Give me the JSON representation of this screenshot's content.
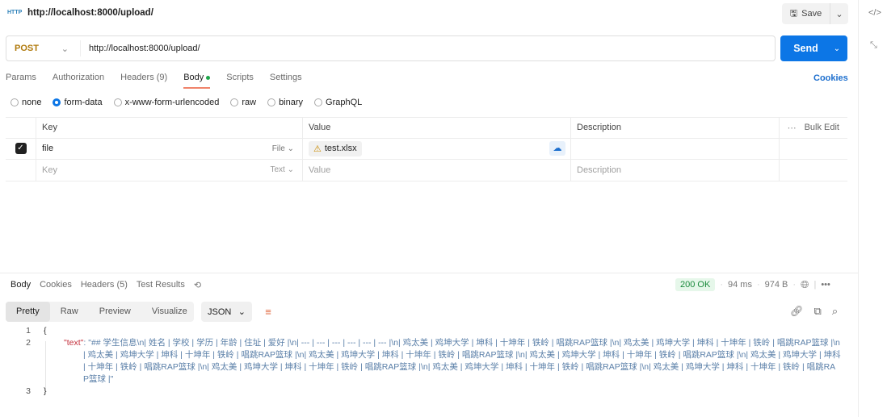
{
  "header": {
    "title": "http://localhost:8000/upload/",
    "logo_text": "HTTP",
    "save_label": "Save"
  },
  "request": {
    "method": "POST",
    "url": "http://localhost:8000/upload/",
    "send_label": "Send"
  },
  "tabs": [
    {
      "label": "Params"
    },
    {
      "label": "Authorization"
    },
    {
      "label": "Headers (9)"
    },
    {
      "label": "Body"
    },
    {
      "label": "Scripts"
    },
    {
      "label": "Settings"
    }
  ],
  "cookies_label": "Cookies",
  "body_types": [
    {
      "label": "none"
    },
    {
      "label": "form-data"
    },
    {
      "label": "x-www-form-urlencoded"
    },
    {
      "label": "raw"
    },
    {
      "label": "binary"
    },
    {
      "label": "GraphQL"
    }
  ],
  "table": {
    "headers": {
      "key": "Key",
      "value": "Value",
      "description": "Description",
      "bulk": "Bulk Edit"
    },
    "rows": [
      {
        "key": "file",
        "type": "File",
        "value": "test.xlsx",
        "description": ""
      }
    ],
    "placeholder": {
      "key": "Key",
      "type": "Text",
      "value": "Value",
      "description": "Description"
    }
  },
  "response": {
    "tabs": [
      {
        "label": "Body"
      },
      {
        "label": "Cookies"
      },
      {
        "label": "Headers (5)"
      },
      {
        "label": "Test Results"
      }
    ],
    "status": "200 OK",
    "time": "94 ms",
    "size": "974 B",
    "views": [
      {
        "label": "Pretty"
      },
      {
        "label": "Raw"
      },
      {
        "label": "Preview"
      },
      {
        "label": "Visualize"
      }
    ],
    "format": "JSON",
    "line_numbers": [
      "1",
      "2",
      "3"
    ],
    "open_brace": "{",
    "close_brace": "}",
    "key": "\"text\"",
    "value": ": \"## 学生信息\\n| 姓名 | 学校 | 学历 | 年龄 | 住址 | 爱好 |\\n| --- | --- | --- | --- | --- | --- |\\n| 鸡太美 | 鸡坤大学 | 坤科 | 十坤年 | 铁岭 | 唱跳RAP篮球 |\\n| 鸡太美 | 鸡坤大学 | 坤科 | 十坤年 | 铁岭 | 唱跳RAP篮球 |\\n| 鸡太美 | 鸡坤大学 | 坤科 | 十坤年 | 铁岭 | 唱跳RAP篮球 |\\n| 鸡太美 | 鸡坤大学 | 坤科 | 十坤年 | 铁岭 | 唱跳RAP篮球 |\\n| 鸡太美 | 鸡坤大学 | 坤科 | 十坤年 | 铁岭 | 唱跳RAP篮球 |\\n| 鸡太美 | 鸡坤大学 | 坤科 | 十坤年 | 铁岭 | 唱跳RAP篮球 |\\n| 鸡太美 | 鸡坤大学 | 坤科 | 十坤年 | 铁岭 | 唱跳RAP篮球 |\\n| 鸡太美 | 鸡坤大学 | 坤科 | 十坤年 | 铁岭 | 唱跳RAP篮球 |\\n| 鸡太美 | 鸡坤大学 | 坤科 | 十坤年 | 铁岭 | 唱跳RAP篮球 |\""
  }
}
